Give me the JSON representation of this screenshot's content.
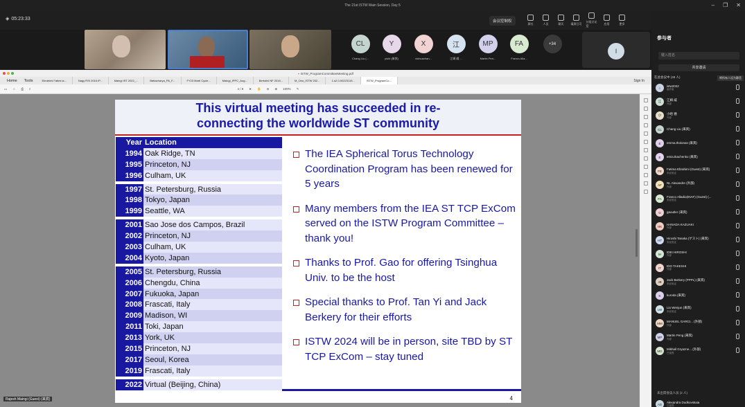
{
  "window": {
    "title": "The 21st ISTW Main Session, Day 5"
  },
  "toolbar": {
    "time": "05:23:33",
    "record": "会议控制权",
    "items": [
      "屏社",
      "人员",
      "聊天",
      "填屏日可",
      "分组讨论室",
      "应用",
      "更多"
    ],
    "end": "离开"
  },
  "videos": {
    "speaker_name": "Rajesh Maingi (Guest) (来宾)"
  },
  "attendees": [
    {
      "initials": "CL",
      "color": "#c4d4cf",
      "name": "Chang Liu (..."
    },
    {
      "initials": "Y",
      "color": "#e6d8e8",
      "name": "yiuhi (来宾)"
    },
    {
      "initials": "X",
      "color": "#f2d3d3",
      "name": "xiuhuachan..."
    },
    {
      "initials": "江",
      "color": "#d4e3ef",
      "name": "江姆 威 ..."
    },
    {
      "initials": "MP",
      "color": "#d3d0ec",
      "name": "Martin Pen..."
    },
    {
      "initials": "FA",
      "color": "#d8ead0",
      "name": "Franco Alla..."
    }
  ],
  "more_count": "+34",
  "extra_avatar": "I",
  "pdf": {
    "file": "ISTW_ProgramCommitteeMeeting.pdf",
    "home": "Home",
    "tools": "Tools",
    "tabs": [
      "Ebrahimi Fatimi la...",
      "Nagy RSI 2016 IP...",
      "Maingi IST 2022_...",
      "Battacharya_PA_F...",
      "FY23 Martí Cycle...",
      "Maingi_IPPC_Aug...",
      "Bertolini NF 2016...",
      "M_Ono_ISTW 202...",
      "1-s2.0-00223115...",
      "ISTW_ProgramCo..."
    ],
    "signin": "Sign In",
    "page": "4 / 8",
    "zoom": "100%"
  },
  "slide": {
    "title_line1": "This virtual meeting has succeeded in re-",
    "title_line2": "connecting the worldwide ST community",
    "header_year": "Year",
    "header_loc": "Location",
    "rows": [
      [
        "1994",
        "Oak Ridge, TN"
      ],
      [
        "1995",
        "Princeton, NJ"
      ],
      [
        "1996",
        "Culham, UK"
      ],
      [
        "",
        ""
      ],
      [
        "1997",
        "St. Petersburg, Russia"
      ],
      [
        "1998",
        "Tokyo, Japan"
      ],
      [
        "1999",
        "Seattle, WA"
      ],
      [
        "",
        ""
      ],
      [
        "2001",
        "Sao Jose dos Campos, Brazil"
      ],
      [
        "2002",
        "Princeton, NJ"
      ],
      [
        "2003",
        "Culham, UK"
      ],
      [
        "2004",
        "Kyoto, Japan"
      ],
      [
        "",
        ""
      ],
      [
        "2005",
        "St. Petersburg, Russia"
      ],
      [
        "2006",
        "Chengdu, China"
      ],
      [
        "2007",
        "Fukuoka, Japan"
      ],
      [
        "2008",
        "Frascati, Italy"
      ],
      [
        "2009",
        "Madison, WI"
      ],
      [
        "2011",
        "Toki, Japan"
      ],
      [
        "2013",
        "York, UK"
      ],
      [
        "2015",
        "Princeton, NJ"
      ],
      [
        "2017",
        "Seoul, Korea"
      ],
      [
        "2019",
        "Frascati, Italy"
      ],
      [
        "",
        ""
      ],
      [
        "2022",
        "Virtual (Beijing, China)"
      ]
    ],
    "bullets": [
      "The IEA Spherical Torus Technology Coordination Program has been renewed for 5 years",
      "Many members from the IEA ST TCP ExCom served on the ISTW Program Committee – thank you!",
      "Thanks to Prof. Gao for offering Tsinghua Univ. to be the host",
      "Special thanks to Prof. Tan Yi and Jack Berkery for their efforts",
      "ISTW 2024 will be in person, site TBD by ST TCP ExCom – stay tuned"
    ],
    "page_number": "4"
  },
  "panel": {
    "title": "参与者",
    "search": "键入姓名",
    "share": "共享邀请",
    "section": "在此会议中 (48 人)",
    "mute_all": "将所有人设为静音",
    "people": [
      {
        "i": "I",
        "c": "#c9d4e0",
        "n1": "istw2022",
        "n2": "组织者"
      },
      {
        "i": "江",
        "c": "#cfe0d8",
        "n1": "江姆 威",
        "n2": "外部"
      },
      {
        "i": "小",
        "c": "#e6e0c8",
        "n1": "小哈 德",
        "n2": "外部"
      },
      {
        "i": "CL",
        "c": "#c4d4cf",
        "n1": "Chang Liu (来宾)",
        "n2": ""
      },
      {
        "i": "E",
        "c": "#e0d0ea",
        "n1": "emma.tholonas (来宾)",
        "n2": ""
      },
      {
        "i": "E",
        "c": "#e3d3ee",
        "n1": "emia.tkachenko (来宾)",
        "n2": ""
      },
      {
        "i": "FE",
        "c": "#f2d9c8",
        "n1": "Fatima Ebrahimi (Guest) (来宾)",
        "n2": "未经验证"
      },
      {
        "i": "AF",
        "c": "#f5e1b8",
        "n1": "NL Alexandre (外部)",
        "n2": "外部"
      },
      {
        "i": "FA",
        "c": "#d8ead0",
        "n1": "Franco Alladio(INAF) (Guest) (...",
        "n2": "未经验证"
      },
      {
        "i": "G",
        "c": "#f0d0d8",
        "n1": "gaoutler (来宾)",
        "n2": ""
      },
      {
        "i": "HK",
        "c": "#f2ccc0",
        "n1": "HANADA KAZUAKI",
        "n2": "外部"
      },
      {
        "i": "HT",
        "c": "#d0dcf0",
        "n1": "Hiroshi Tanaka (ゲスト) (来宾)",
        "n2": "未经验证"
      },
      {
        "i": "IH",
        "c": "#d4e8d4",
        "n1": "IDEI HIROSHI",
        "n2": "外部"
      },
      {
        "i": "IT",
        "c": "#f0d6cc",
        "n1": "IDO TAKESHI",
        "n2": "外部"
      },
      {
        "i": "JB",
        "c": "#e0d0c0",
        "n1": "Jack Berkery (PPPL) (来宾)",
        "n2": "未经验证"
      },
      {
        "i": "K",
        "c": "#dcd0ec",
        "n1": "kuroda (来宾)",
        "n2": ""
      },
      {
        "i": "LW",
        "c": "#d0e4ea",
        "n1": "Liu Wenjun (来宾)",
        "n2": "未经验证"
      },
      {
        "i": "MM",
        "c": "#f0d8c8",
        "n1": "MANUEL GARCI... (外部)",
        "n2": "外部"
      },
      {
        "i": "MP",
        "c": "#d3d0ec",
        "n1": "Martin Peng (来宾)",
        "n2": "外部"
      },
      {
        "i": "MG",
        "c": "#d8e6d0",
        "n1": "Mikhail Gryazne... (外部)",
        "n2": "已接受"
      }
    ],
    "section2": "已被此会议",
    "section3": "未出席会议人员 (2 人)",
    "extra": {
      "i": "AD",
      "c": "#c8d8e0",
      "n1": "Alexandra Dudkovskaia",
      "n2": "已接受"
    }
  }
}
